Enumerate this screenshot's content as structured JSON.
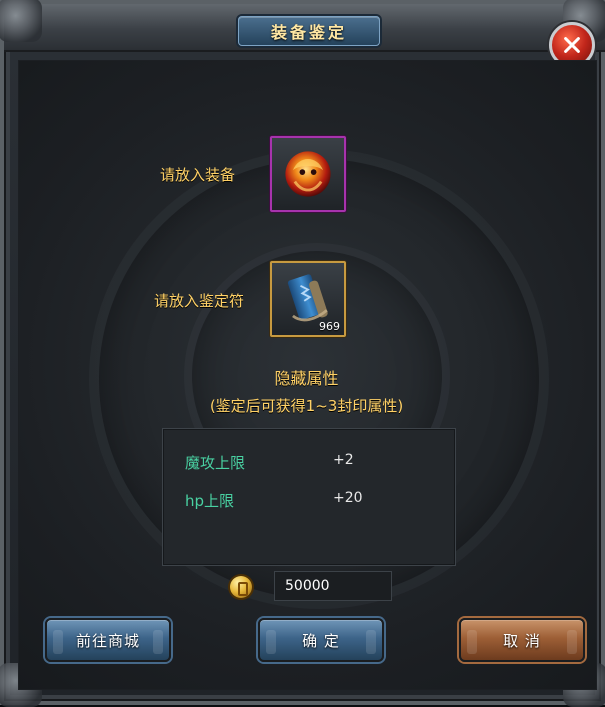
{
  "window": {
    "title": "装备鉴定",
    "close_icon": "close-icon"
  },
  "slots": {
    "equip": {
      "label": "请放入装备",
      "item_icon": "dragon-orb-icon"
    },
    "charm": {
      "label": "请放入鉴定符",
      "item_icon": "appraisal-scroll-icon",
      "quantity": "969"
    }
  },
  "hidden_attributes": {
    "title": "隐藏属性",
    "note": "(鉴定后可获得1~3封印属性)",
    "rows": [
      {
        "name": "魔攻上限",
        "value": "+2"
      },
      {
        "name": "hp上限",
        "value": "+20"
      }
    ]
  },
  "cost": {
    "amount": "50000",
    "currency_icon": "gold-coin-icon"
  },
  "buttons": {
    "shop": "前往商城",
    "confirm": "确 定",
    "cancel": "取 消"
  },
  "colors": {
    "gold_text": "#ffd166",
    "attr_name": "#49d1a2",
    "equip_border": "#a733ad",
    "charm_border": "#c79a40"
  }
}
